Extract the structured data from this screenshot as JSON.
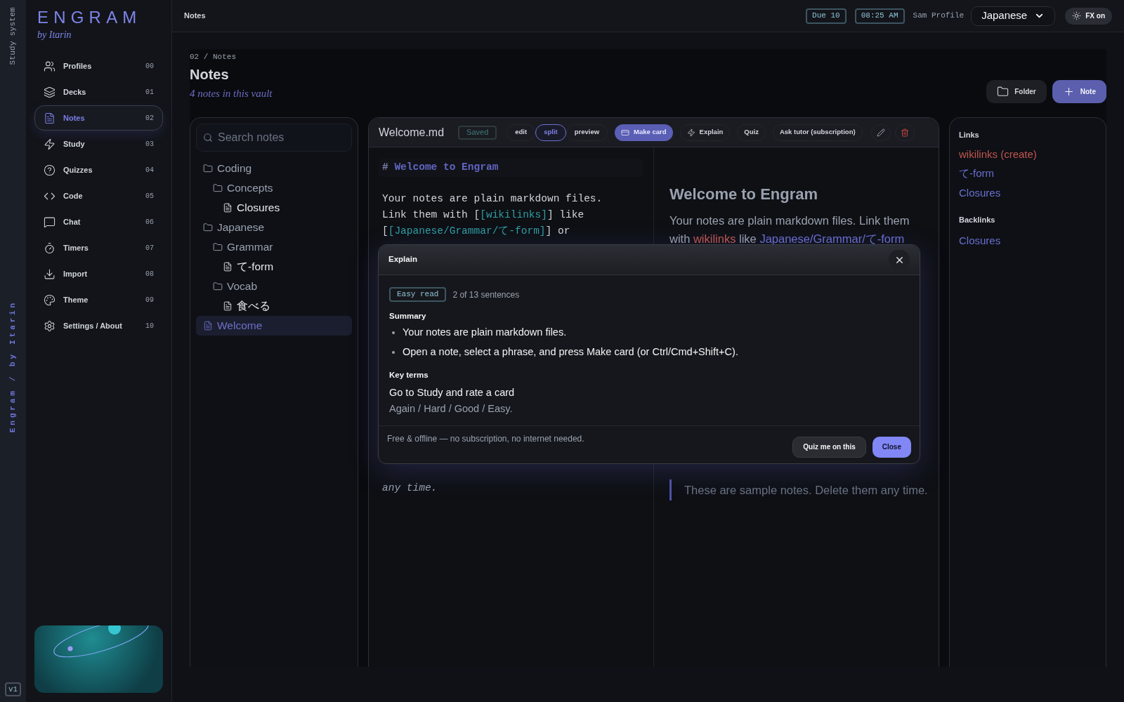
{
  "rail": {
    "top_label": "Study system",
    "bottom_label": "Engram / by Itarin",
    "version": "v1"
  },
  "brand": {
    "name": "ENGRAM",
    "byline": "by Itarin"
  },
  "nav": [
    {
      "label": "Profiles",
      "number": "00",
      "selected": false
    },
    {
      "label": "Decks",
      "number": "01",
      "selected": false
    },
    {
      "label": "Notes",
      "number": "02",
      "selected": true
    },
    {
      "label": "Study",
      "number": "03",
      "selected": false
    },
    {
      "label": "Quizzes",
      "number": "04",
      "selected": false
    },
    {
      "label": "Code",
      "number": "05",
      "selected": false
    },
    {
      "label": "Chat",
      "number": "06",
      "selected": false
    },
    {
      "label": "Timers",
      "number": "07",
      "selected": false
    },
    {
      "label": "Import",
      "number": "08",
      "selected": false
    },
    {
      "label": "Theme",
      "number": "09",
      "selected": false
    },
    {
      "label": "Settings / About",
      "number": "10",
      "selected": false
    }
  ],
  "topbar": {
    "title": "Notes",
    "due": "Due 10",
    "time": "08:25 AM",
    "profile": "Sam Profile",
    "language": "Japanese",
    "fx": "FX on"
  },
  "header": {
    "breadcrumb": "02 / Notes",
    "title": "Notes",
    "subtitle": "4 notes in this vault",
    "buttons": [
      {
        "kind": "secondary",
        "label": "Folder"
      },
      {
        "kind": "primary",
        "label": "Note"
      }
    ]
  },
  "tree": {
    "placeholder": "Search notes",
    "items": [
      {
        "kind": "folder",
        "label": "Coding",
        "selected": false,
        "children": [
          {
            "kind": "folder",
            "label": "Concepts",
            "selected": false,
            "children": [
              {
                "kind": "file",
                "label": "Closures",
                "selected": false
              }
            ]
          }
        ]
      },
      {
        "kind": "folder",
        "label": "Japanese",
        "selected": false,
        "children": [
          {
            "kind": "folder",
            "label": "Grammar",
            "selected": false,
            "children": [
              {
                "kind": "file",
                "label": "て-form",
                "selected": false
              }
            ]
          },
          {
            "kind": "folder",
            "label": "Vocab",
            "selected": false,
            "children": [
              {
                "kind": "file",
                "label": "食べる",
                "selected": false
              }
            ]
          }
        ]
      },
      {
        "kind": "file",
        "label": "Welcome",
        "selected": true
      }
    ]
  },
  "editor": {
    "filename": "Welcome.md",
    "status": "Saved",
    "views": [
      {
        "label": "edit",
        "selected": false
      },
      {
        "label": "split",
        "selected": true
      },
      {
        "label": "preview",
        "selected": false
      }
    ],
    "actions": [
      {
        "kind": "primary",
        "label": "Make card"
      },
      {
        "kind": "plain",
        "label": "Explain"
      },
      {
        "kind": "plain",
        "label": "Quiz"
      },
      {
        "kind": "plain",
        "label": "Ask tutor (subscription)"
      }
    ],
    "source": {
      "heading_mark": "#",
      "heading": "Welcome to Engram",
      "paragraph": [
        {
          "kind": "plain",
          "text": "Your notes are plain markdown files. Link them with ["
        },
        {
          "kind": "link",
          "text": "[wikilinks]"
        },
        {
          "kind": "plain",
          "text": "] like ["
        },
        {
          "kind": "link",
          "text": "[Japanese/Grammar/て-form]"
        },
        {
          "kind": "plain",
          "text": "] or"
        }
      ],
      "tail": "any time."
    },
    "preview": {
      "heading": "Welcome to Engram",
      "paragraph": [
        {
          "kind": "plain",
          "text": "Your notes are plain markdown files. Link them with "
        },
        {
          "kind": "missing",
          "text": "wikilinks"
        },
        {
          "kind": "plain",
          "text": " like "
        },
        {
          "kind": "link",
          "text": "Japanese/Grammar/て-form"
        }
      ],
      "quote": "These are sample notes. Delete them any time."
    }
  },
  "links_panel": {
    "links_title": "Links",
    "links": [
      {
        "label": "wikilinks (create)",
        "missing": true
      },
      {
        "label": "て-form",
        "missing": false
      },
      {
        "label": "Closures",
        "missing": false
      }
    ],
    "backlinks_title": "Backlinks",
    "backlinks": [
      {
        "label": "Closures",
        "missing": false
      }
    ]
  },
  "dialog": {
    "title": "Explain",
    "badge": "Easy read",
    "progress": "2 of 13 sentences",
    "summary_title": "Summary",
    "summary": [
      "Your notes are plain markdown files.",
      "Open a note, select a phrase, and press Make card (or Ctrl/Cmd+Shift+C)."
    ],
    "terms_title": "Key terms",
    "terms": [
      {
        "term": "Go to Study and rate a card",
        "definition": "Again / Hard / Good / Easy."
      }
    ],
    "footnote": "Free & offline — no subscription, no internet needed.",
    "buttons": [
      {
        "kind": "secondary",
        "label": "Quiz me on this"
      },
      {
        "kind": "primary",
        "label": "Close"
      }
    ]
  }
}
